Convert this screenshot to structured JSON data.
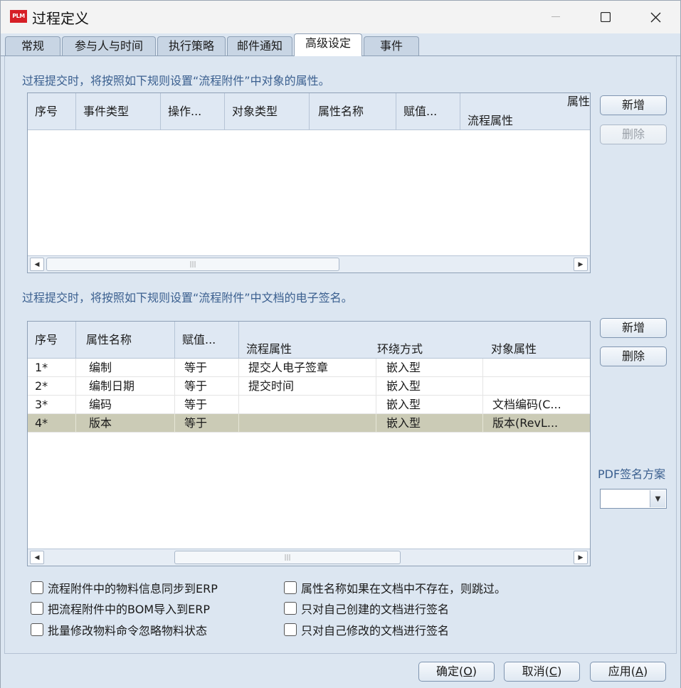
{
  "window": {
    "title": "过程定义",
    "icon_label": "PLM"
  },
  "tabs": [
    {
      "label": "常规"
    },
    {
      "label": "参与人与时间"
    },
    {
      "label": "执行策略"
    },
    {
      "label": "邮件通知"
    },
    {
      "label": "高级设定"
    },
    {
      "label": "事件"
    }
  ],
  "section1": {
    "label": "过程提交时，将按照如下规则设置“流程附件”中对象的属性。",
    "columns": [
      "序号",
      "事件类型",
      "操作...",
      "对象类型",
      "属性名称",
      "赋值..."
    ],
    "group_header": "属性",
    "sub_column": "流程属性",
    "add_button": "新增",
    "delete_button": "删除"
  },
  "section2": {
    "label": "过程提交时，将按照如下规则设置“流程附件”中文档的电子签名。",
    "columns": [
      "序号",
      "属性名称",
      "赋值...",
      "流程属性",
      "环绕方式",
      "对象属性"
    ],
    "rows": [
      {
        "idx": "1*",
        "attr": "编制",
        "assign": "等于",
        "flow": "提交人电子签章",
        "wrap": "嵌入型",
        "obj": ""
      },
      {
        "idx": "2*",
        "attr": "编制日期",
        "assign": "等于",
        "flow": "提交时间",
        "wrap": "嵌入型",
        "obj": ""
      },
      {
        "idx": "3*",
        "attr": "编码",
        "assign": "等于",
        "flow": "",
        "wrap": "嵌入型",
        "obj": "文档编码(C..."
      },
      {
        "idx": "4*",
        "attr": "版本",
        "assign": "等于",
        "flow": "",
        "wrap": "嵌入型",
        "obj": "版本(RevL..."
      }
    ],
    "selected_row": 4,
    "add_button": "新增",
    "delete_button": "删除",
    "pdf_scheme_label": "PDF签名方案",
    "pdf_scheme_value": ""
  },
  "options": {
    "left": [
      {
        "label": "流程附件中的物料信息同步到ERP",
        "checked": false
      },
      {
        "label": "把流程附件中的BOM导入到ERP",
        "checked": false
      },
      {
        "label": "批量修改物料命令忽略物料状态",
        "checked": false
      }
    ],
    "right": [
      {
        "label": "属性名称如果在文档中不存在，则跳过。",
        "checked": false
      },
      {
        "label": "只对自己创建的文档进行签名",
        "checked": false
      },
      {
        "label": "只对自己修改的文档进行签名",
        "checked": false
      }
    ]
  },
  "footer": {
    "ok_label": "确定",
    "ok_key": "O",
    "cancel_label": "取消",
    "cancel_key": "C",
    "apply_label": "应用",
    "apply_key": "A"
  },
  "colors": {
    "background": "#dce6f1",
    "selected_row": "#cbcbb6",
    "label_blue": "#3a5f8f",
    "icon_red": "#d61f26"
  }
}
